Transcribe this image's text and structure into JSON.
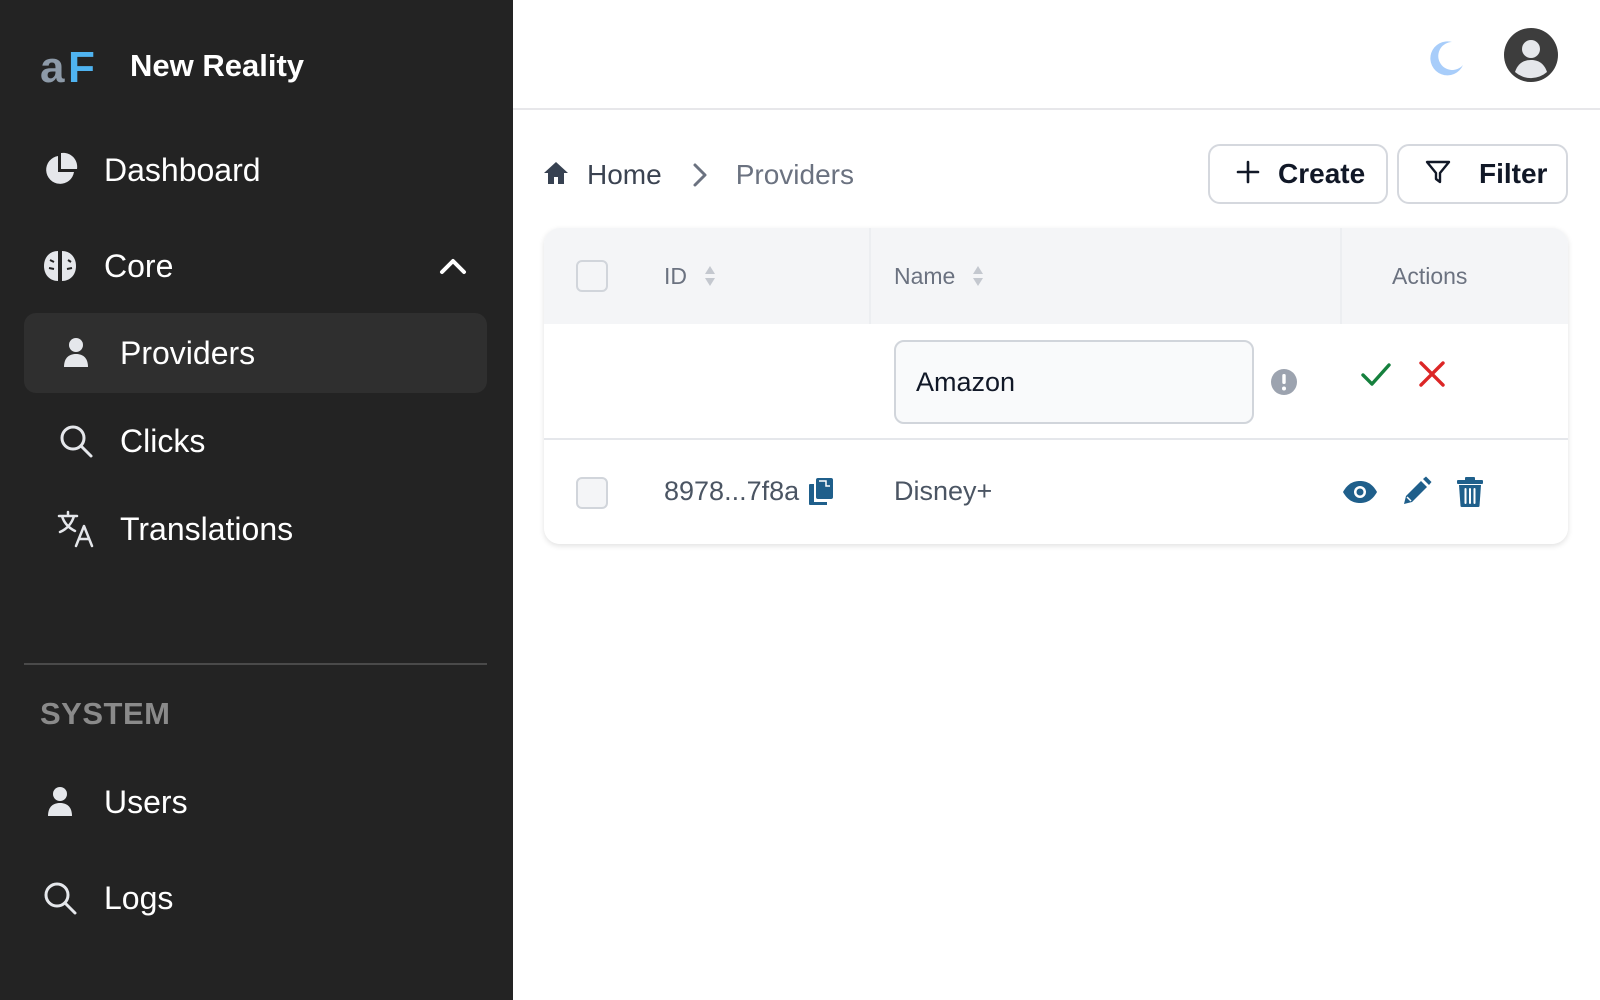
{
  "brand": {
    "name": "New Reality",
    "logo_text": "aF"
  },
  "sidebar": {
    "items": [
      {
        "label": "Dashboard",
        "icon": "pie-chart-icon"
      },
      {
        "label": "Core",
        "icon": "brain-icon",
        "expanded": true,
        "children": [
          {
            "label": "Providers",
            "icon": "user-icon",
            "active": true
          },
          {
            "label": "Clicks",
            "icon": "search-icon"
          },
          {
            "label": "Translations",
            "icon": "translate-icon"
          }
        ]
      }
    ],
    "section_label": "SYSTEM",
    "system_items": [
      {
        "label": "Users",
        "icon": "user-icon"
      },
      {
        "label": "Logs",
        "icon": "search-icon"
      }
    ]
  },
  "topbar": {
    "theme_icon": "moon-icon",
    "avatar_icon": "user-circle-icon"
  },
  "breadcrumb": {
    "home": "Home",
    "current": "Providers"
  },
  "toolbar": {
    "create_label": "Create",
    "filter_label": "Filter"
  },
  "table": {
    "columns": {
      "id": "ID",
      "name": "Name",
      "actions": "Actions"
    },
    "edit_row": {
      "name_value": "Amazon"
    },
    "rows": [
      {
        "id": "8978...7f8a",
        "name": "Disney+"
      }
    ]
  },
  "colors": {
    "sidebar_bg": "#232323",
    "accent_blue": "#1f5f8b",
    "confirm_green": "#15803d",
    "cancel_red": "#dc2626",
    "moon": "#a8cdfa"
  }
}
